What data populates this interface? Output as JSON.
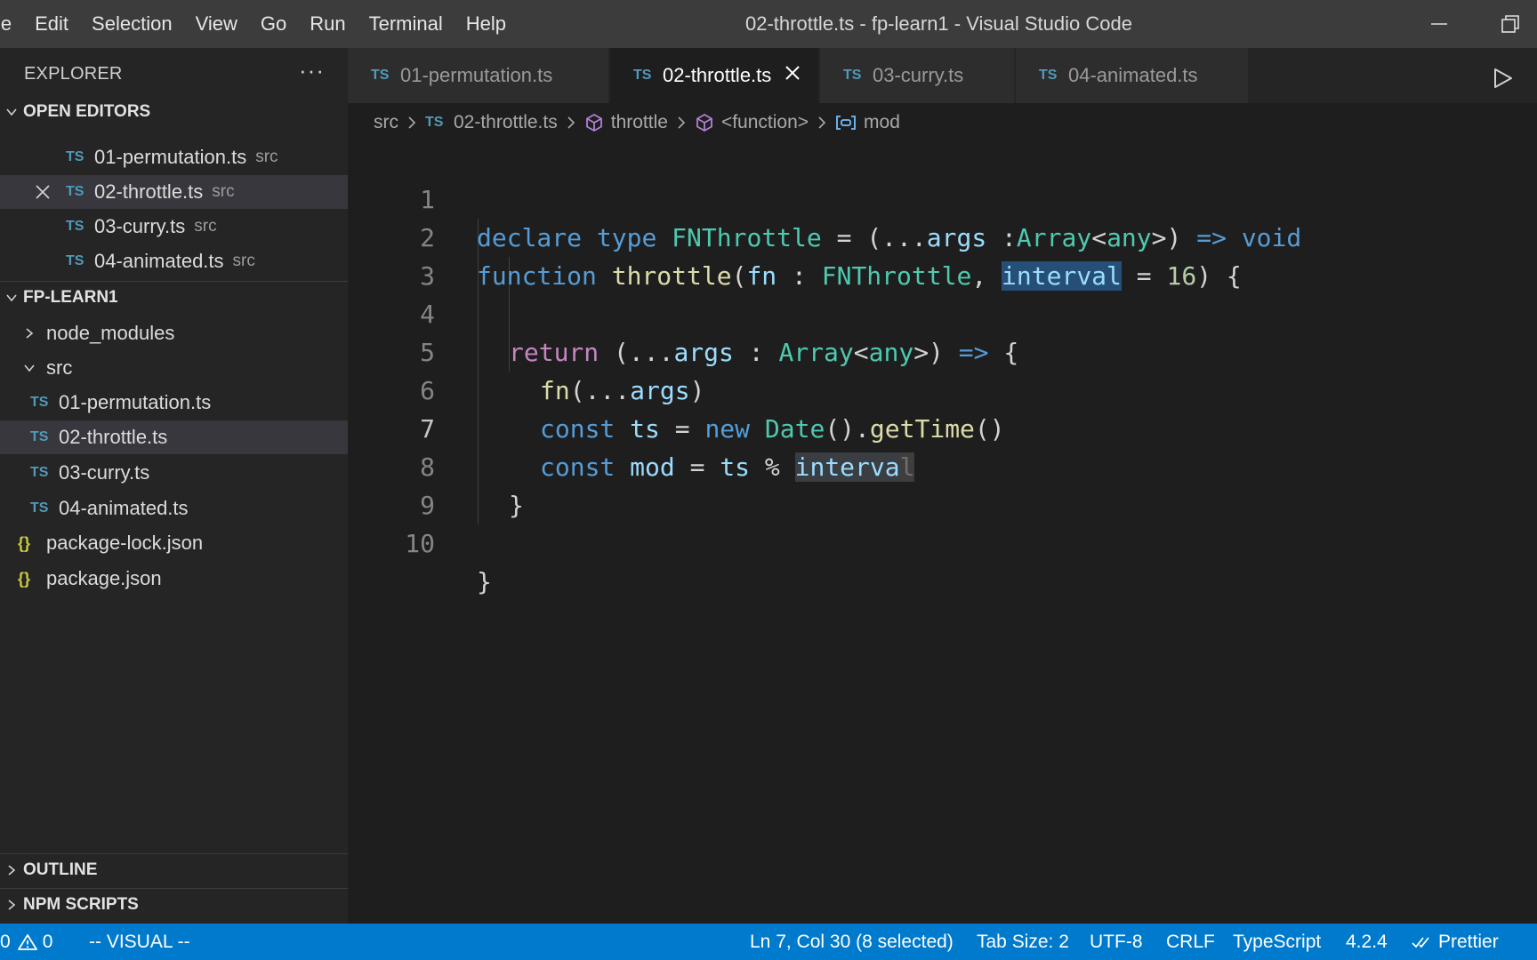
{
  "menu": [
    "le",
    "Edit",
    "Selection",
    "View",
    "Go",
    "Run",
    "Terminal",
    "Help"
  ],
  "window_title": "02-throttle.ts - fp-learn1 - Visual Studio Code",
  "sidebar": {
    "title": "EXPLORER",
    "more": "···",
    "open_editors_label": "OPEN EDITORS",
    "open_editors": [
      {
        "badge": "TS",
        "name": "01-permutation.ts",
        "dir": "src"
      },
      {
        "badge": "TS",
        "name": "02-throttle.ts",
        "dir": "src"
      },
      {
        "badge": "TS",
        "name": "03-curry.ts",
        "dir": "src"
      },
      {
        "badge": "TS",
        "name": "04-animated.ts",
        "dir": "src"
      }
    ],
    "project_label": "FP-LEARN1",
    "tree": [
      {
        "name": "node_modules"
      },
      {
        "name": "src"
      },
      {
        "badge": "TS",
        "name": "01-permutation.ts"
      },
      {
        "badge": "TS",
        "name": "02-throttle.ts"
      },
      {
        "badge": "TS",
        "name": "03-curry.ts"
      },
      {
        "badge": "TS",
        "name": "04-animated.ts"
      },
      {
        "badge": "{}",
        "name": "package-lock.json"
      },
      {
        "badge": "{}",
        "name": "package.json"
      }
    ],
    "outline_label": "OUTLINE",
    "npm_scripts_label": "NPM SCRIPTS"
  },
  "tabs": [
    {
      "badge": "TS",
      "label": "01-permutation.ts"
    },
    {
      "badge": "TS",
      "label": "02-throttle.ts",
      "active": true
    },
    {
      "badge": "TS",
      "label": "03-curry.ts"
    },
    {
      "badge": "TS",
      "label": "04-animated.ts"
    }
  ],
  "breadcrumbs": {
    "folder": "src",
    "file_badge": "TS",
    "file": "02-throttle.ts",
    "function": "throttle",
    "inner": "<function>",
    "variable": "mod"
  },
  "code": {
    "line_numbers": [
      "1",
      "2",
      "3",
      "4",
      "5",
      "6",
      "7",
      "8",
      "9",
      "10"
    ],
    "tokens": {
      "l1_declare": "declare",
      "l1_type": "type",
      "l1_name": "FNThrottle",
      "l1_eq": " = (...",
      "l1_args": "args",
      "l1_colon": " :",
      "l1_array": "Array",
      "l1_lt": "<",
      "l1_any": "any",
      "l1_gt": ">) ",
      "l1_arrow": "=>",
      "l1_void": "void",
      "l2_function": "function",
      "l2_name": "throttle",
      "l2_open": "(",
      "l2_fn": "fn",
      "l2_colon": " : ",
      "l2_type": "FNThrottle",
      "l2_comma": ", ",
      "l2_interval": "interval",
      "l2_eq": " = ",
      "l2_num": "16",
      "l2_close": ") {",
      "l4_return": "return",
      "l4_open": " (...",
      "l4_args": "args",
      "l4_colon": " : ",
      "l4_array": "Array",
      "l4_lt": "<",
      "l4_any": "any",
      "l4_gt": ">) ",
      "l4_arrow": "=>",
      "l4_brace": " {",
      "l5_fn": "fn",
      "l5_open": "(...",
      "l5_args": "args",
      "l5_close": ")",
      "l6_const": "const",
      "l6_ts": "ts",
      "l6_eq": " = ",
      "l6_new": "new",
      "l6_date": "Date",
      "l6_call": "().",
      "l6_gettime": "getTime",
      "l6_end": "()",
      "l7_const": "const",
      "l7_mod": "mod",
      "l7_eq": " = ",
      "l7_ts": "ts",
      "l7_pct": " % ",
      "l7_sel": "interva",
      "l7_cursor": "l",
      "l8_brace": "}",
      "l10_brace": "}"
    }
  },
  "status": {
    "errors": "0",
    "warnings": "0",
    "mode": "-- VISUAL --",
    "position": "Ln 7, Col 30 (8 selected)",
    "tab_size": "Tab Size: 2",
    "encoding": "UTF-8",
    "eol": "CRLF",
    "language": "TypeScript",
    "version": "4.2.4",
    "formatter": "Prettier"
  }
}
